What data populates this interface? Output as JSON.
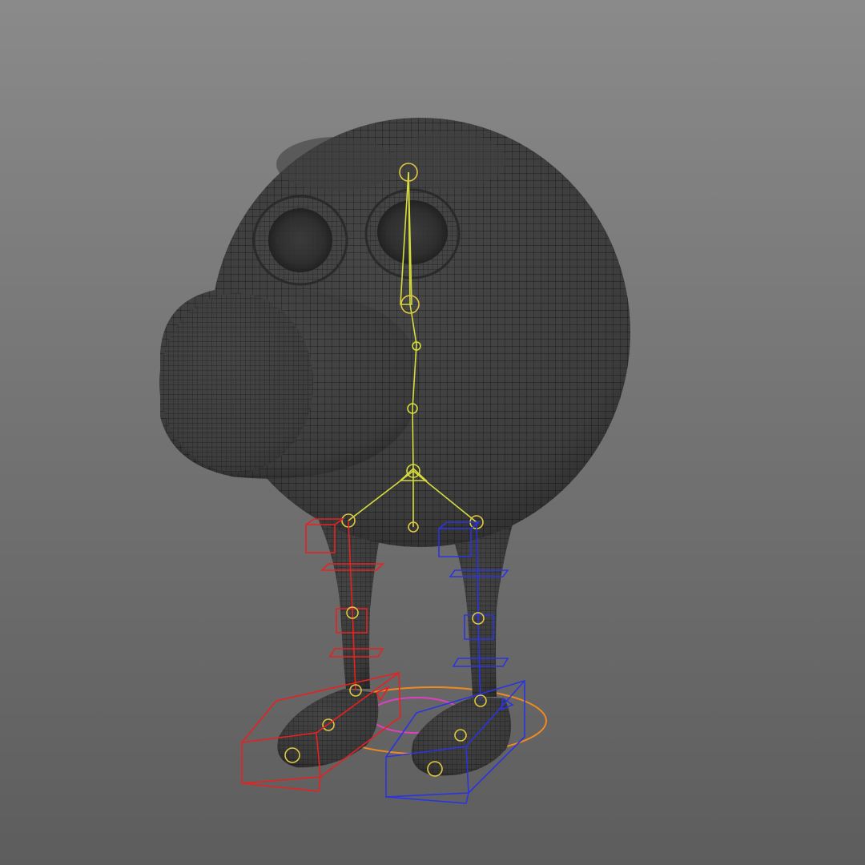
{
  "viewport": {
    "background_top": "#8a8a8a",
    "background_bottom": "#5d5d5d"
  },
  "model": {
    "mesh_fill": "#474747",
    "mesh_dark": "#2e2e2e",
    "wire_color": "#1f1f1f",
    "shading": "wireframe-on-shaded"
  },
  "rig": {
    "spine_color": "#d6dc3c",
    "left_leg_color": "#e82020",
    "right_leg_color": "#2b34e0",
    "root_ring_color": "#f08a20",
    "root_inner_color": "#e040c0",
    "joint_ring_color": "#e0c840"
  }
}
